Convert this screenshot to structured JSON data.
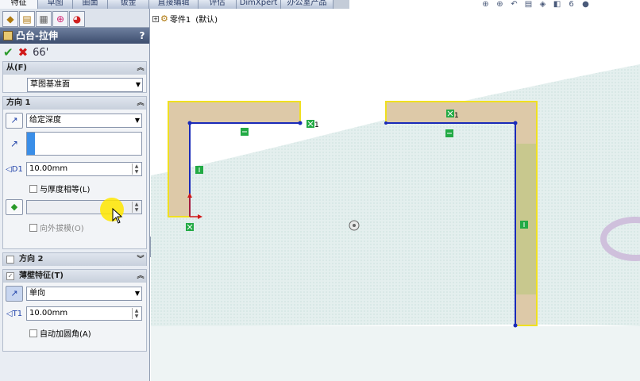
{
  "tabs": [
    "特征",
    "草图",
    "曲面",
    "钣金",
    "直接编辑",
    "评估",
    "DimXpert",
    "办公室产品"
  ],
  "active_tab": 0,
  "panel": {
    "tab_icons": [
      "feature-manager-icon",
      "property-manager-icon",
      "configuration-manager-icon",
      "dimxpert-manager-icon",
      "display-manager-icon"
    ],
    "title": "凸台-拉伸",
    "help": "?",
    "ok_glyph": "✔",
    "cancel_glyph": "✖",
    "preview_glyph": "66'",
    "from": {
      "label": "从(F)",
      "value": "草图基准面"
    },
    "dir1": {
      "label": "方向 1",
      "end_condition": "给定深度",
      "depth": "10.00mm",
      "equal_thickness": "与厚度相等(L)",
      "draft_outward": "向外拔模(O)"
    },
    "dir2": {
      "label": "方向 2"
    },
    "thin": {
      "label": "薄壁特征(T)",
      "type": "单向",
      "thickness": "10.00mm",
      "auto_fillet": "自动加圆角(A)"
    }
  },
  "tree": {
    "part_name": "零件1",
    "config": "(默认)"
  },
  "sketch": {
    "relation_label": "1"
  }
}
